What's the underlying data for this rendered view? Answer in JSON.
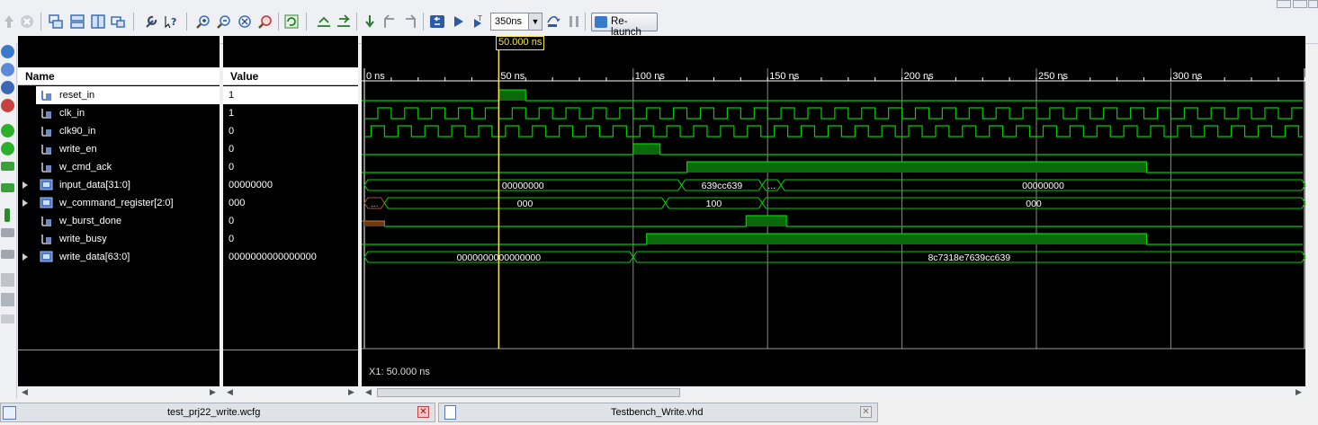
{
  "toolbar": {
    "time_value": "350ns",
    "relaunch_label": "Re-launch"
  },
  "columns": {
    "name": "Name",
    "value": "Value"
  },
  "signals": [
    {
      "name": "reset_in",
      "value": "1",
      "expandable": false,
      "bus": false,
      "selected": true
    },
    {
      "name": "clk_in",
      "value": "1",
      "expandable": false,
      "bus": false
    },
    {
      "name": "clk90_in",
      "value": "0",
      "expandable": false,
      "bus": false
    },
    {
      "name": "write_en",
      "value": "0",
      "expandable": false,
      "bus": false
    },
    {
      "name": "w_cmd_ack",
      "value": "0",
      "expandable": false,
      "bus": false
    },
    {
      "name": "input_data[31:0]",
      "value": "00000000",
      "expandable": true,
      "bus": true
    },
    {
      "name": "w_command_register[2:0]",
      "value": "000",
      "expandable": true,
      "bus": true
    },
    {
      "name": "w_burst_done",
      "value": "0",
      "expandable": false,
      "bus": false
    },
    {
      "name": "write_busy",
      "value": "0",
      "expandable": false,
      "bus": false
    },
    {
      "name": "write_data[63:0]",
      "value": "0000000000000000",
      "expandable": true,
      "bus": true
    }
  ],
  "timeline": {
    "ticks": [
      "0 ns",
      "50 ns",
      "100 ns",
      "150 ns",
      "200 ns",
      "250 ns",
      "300 ns"
    ],
    "cursor_label": "50.000 ns",
    "cursor_readout": "X1: 50.000 ns",
    "bus_labels": {
      "input_data": [
        "00000000",
        "639cc639",
        "...",
        "00000000"
      ],
      "w_command_register": [
        "...",
        "000",
        "100",
        "000"
      ],
      "write_data": [
        "0000000000000000",
        "8c7318e7639cc639"
      ]
    }
  },
  "tabs": [
    {
      "label": "test_prj22_write.wcfg"
    },
    {
      "label": "Testbench_Write.vhd"
    }
  ],
  "colors": {
    "wave": "#00d000",
    "wave_fill": "#0a6a0a",
    "cursor": "#f5e44c",
    "bus_x": "#a0522d"
  }
}
